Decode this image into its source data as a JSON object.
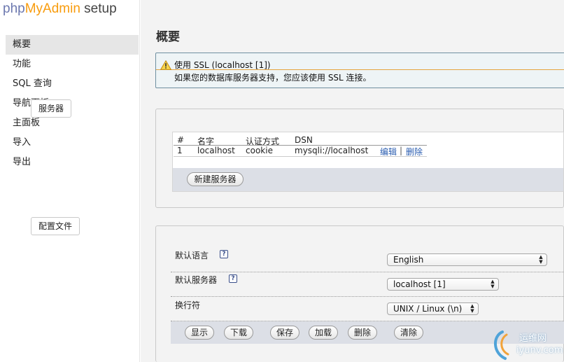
{
  "sidebar": {
    "logo": {
      "part1": "php",
      "part2": "MyAdmin",
      "part3": " setup"
    },
    "items": [
      {
        "label": "概要",
        "active": true
      },
      {
        "label": "功能"
      },
      {
        "label": "SQL 查询"
      },
      {
        "label": "导航面板"
      },
      {
        "label": "主面板"
      },
      {
        "label": "导入"
      },
      {
        "label": "导出"
      }
    ]
  },
  "main": {
    "title": "概要",
    "warning": {
      "icon": "warning-triangle-icon",
      "title": "使用 SSL (localhost [1])",
      "message": "如果您的数据库服务器支持，您应该使用 SSL 连接。"
    },
    "servers": {
      "legend": "服务器",
      "headers": [
        "#",
        "名字",
        "认证方式",
        "DSN"
      ],
      "rows": [
        {
          "num": "1",
          "name": "localhost",
          "auth": "cookie",
          "dsn": "mysqli://localhost",
          "edit": "编辑",
          "sep": "|",
          "delete": "删除"
        }
      ],
      "new_button": "新建服务器"
    },
    "config": {
      "legend": "配置文件",
      "default_language_label": "默认语言",
      "default_language_value": "English",
      "default_server_label": "默认服务器",
      "default_server_value": "localhost [1]",
      "eol_label": "换行符",
      "eol_value": "UNIX / Linux (\\n)",
      "help_glyph": "?",
      "buttons": {
        "display": "显示",
        "download": "下载",
        "save": "保存",
        "load": "加载",
        "delete": "删除",
        "clear": "清除"
      }
    }
  },
  "watermark": {
    "line1": "运维网",
    "line2": "iyunv.com"
  },
  "colors": {
    "accent_orange": "#f89c0e",
    "logo_blue": "#6c78af",
    "link_blue": "#2a5db0",
    "warning_border": "#e5a43f"
  }
}
